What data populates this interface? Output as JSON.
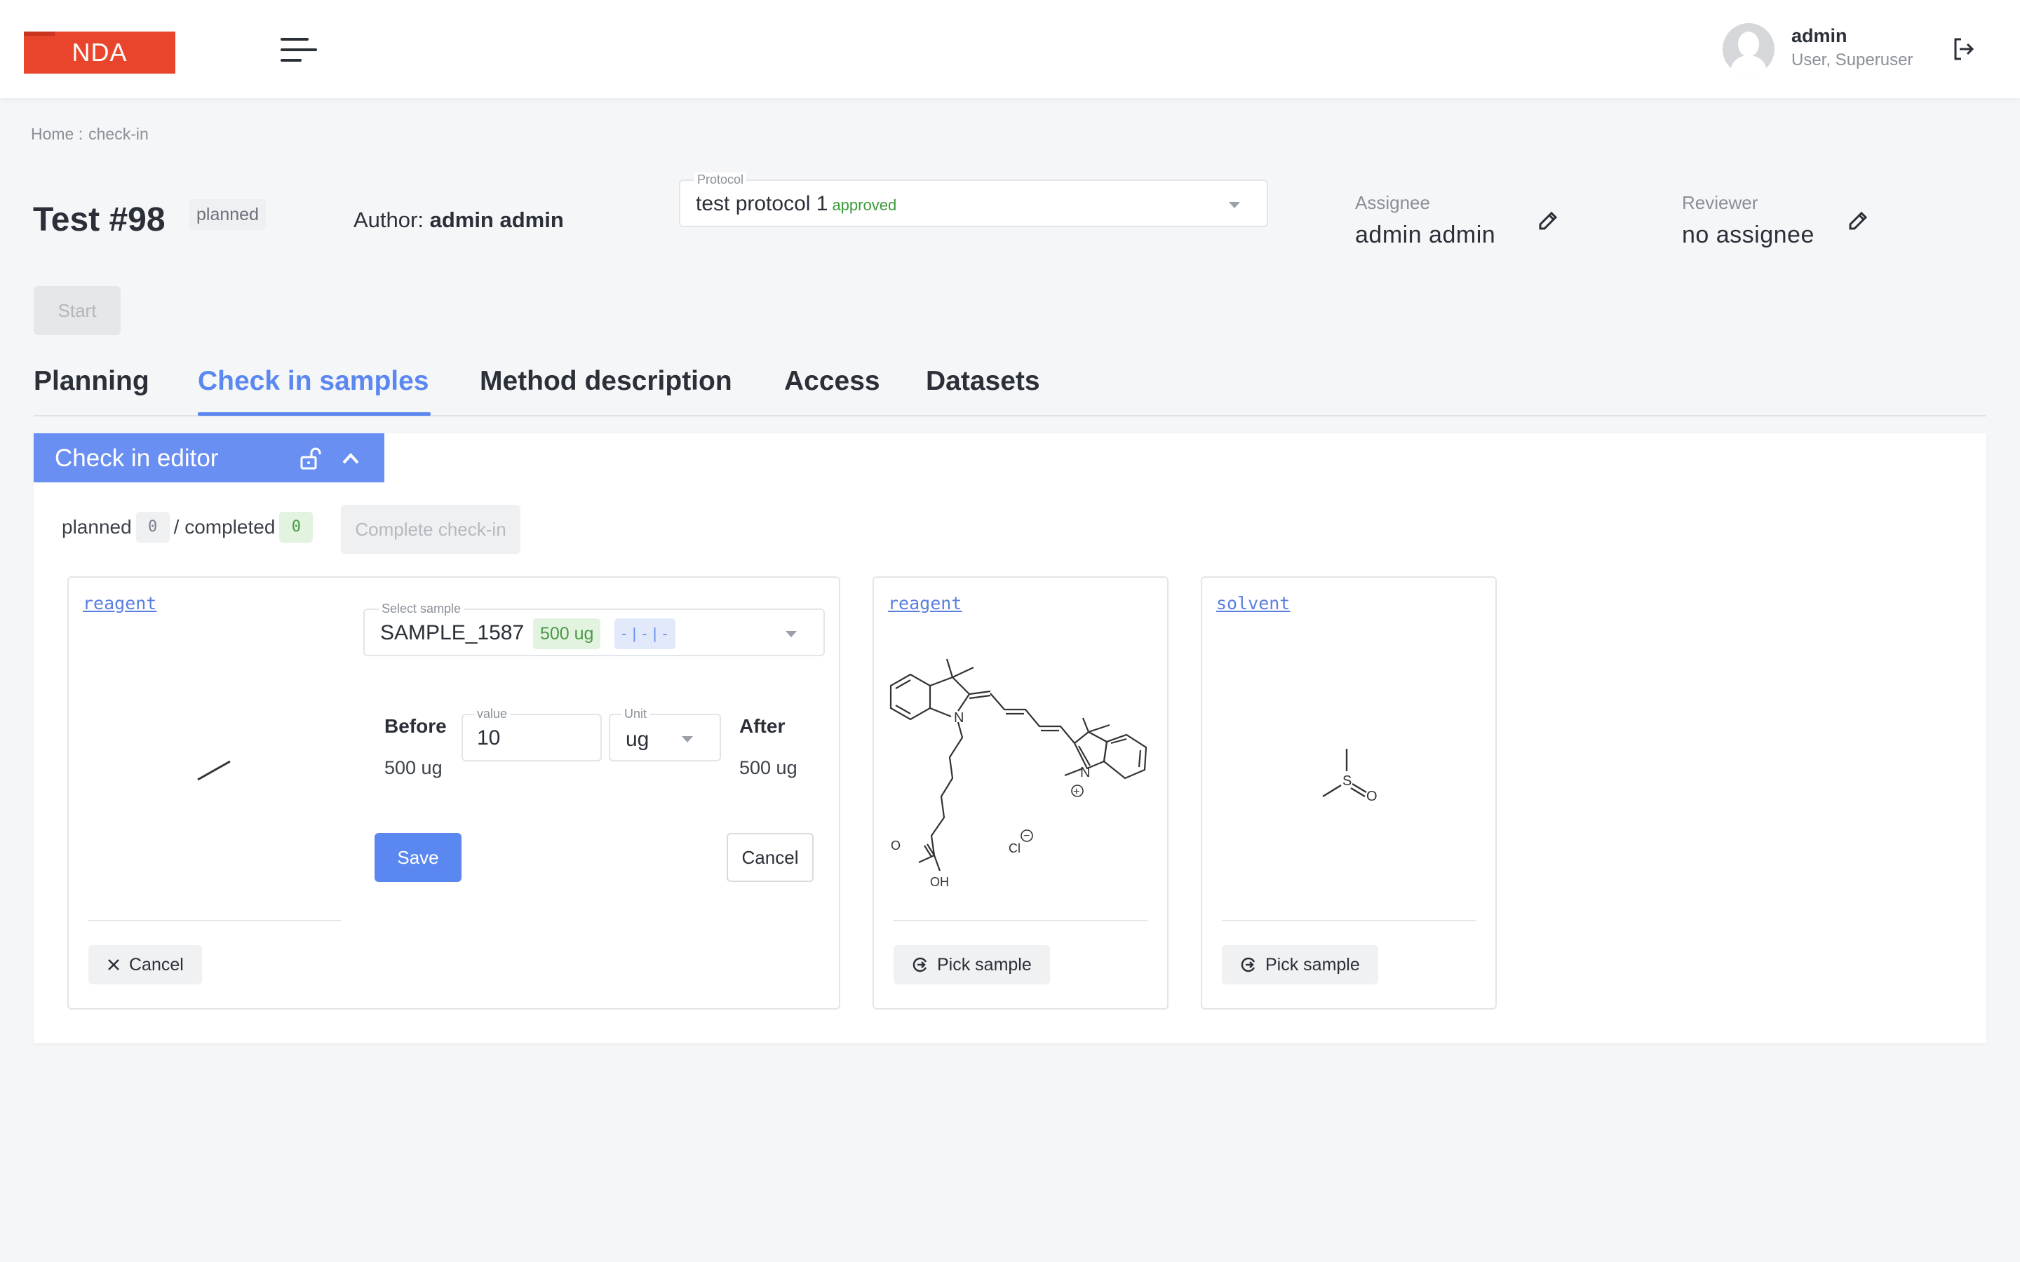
{
  "header": {
    "logo_text": "NDA",
    "user_name": "admin",
    "user_role": "User, Superuser",
    "brand_color": "#e8452c"
  },
  "breadcrumb": {
    "home": "Home :",
    "current": "check-in"
  },
  "test": {
    "title": "Test #98",
    "status": "planned",
    "author_label": "Author:",
    "author_name": "admin admin"
  },
  "protocol": {
    "label": "Protocol",
    "value": "test protocol 1",
    "status": "approved"
  },
  "assignee": {
    "label": "Assignee",
    "value": "admin admin"
  },
  "reviewer": {
    "label": "Reviewer",
    "value": "no assignee"
  },
  "start_button": "Start",
  "tabs": [
    {
      "label": "Planning"
    },
    {
      "label": "Check in samples"
    },
    {
      "label": "Method description"
    },
    {
      "label": "Access"
    },
    {
      "label": "Datasets"
    }
  ],
  "panel": {
    "title": "Check in editor",
    "planned_label": "planned",
    "planned_count": "0",
    "completed_label": "/ completed",
    "completed_count": "0",
    "complete_button": "Complete check-in",
    "accent_color": "#6a8ff3"
  },
  "cards": [
    {
      "type_link": "reagent",
      "select_label": "Select sample",
      "sample_name": "SAMPLE_1587",
      "sample_amount": "500 ug",
      "sample_tag": "- | - | -",
      "before_label": "Before",
      "before_value": "500 ug",
      "value_label": "value",
      "value": "10",
      "unit_label": "Unit",
      "unit": "ug",
      "after_label": "After",
      "after_value": "500 ug",
      "save_button": "Save",
      "cancel_button": "Cancel",
      "card_cancel_button": "Cancel"
    },
    {
      "type_link": "reagent",
      "pick_button": "Pick sample",
      "structure_labels": {
        "n1": "N",
        "n2": "N",
        "plus": "+",
        "cl": "Cl",
        "minus": "−",
        "o": "O",
        "oh": "OH"
      }
    },
    {
      "type_link": "solvent",
      "pick_button": "Pick sample",
      "structure_labels": {
        "s": "S",
        "o": "O"
      }
    }
  ]
}
